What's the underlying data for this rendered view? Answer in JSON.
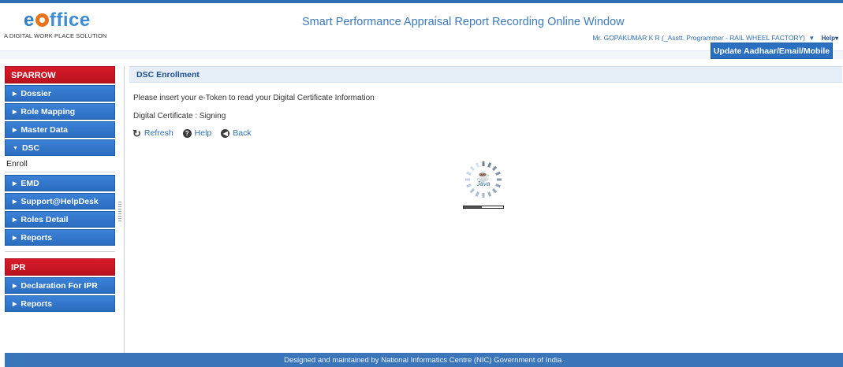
{
  "brand": {
    "logo_e": "e",
    "logo_rest": "ffice",
    "tagline": "A DIGITAL WORK PLACE SOLUTION"
  },
  "header": {
    "title": "Smart Performance Appraisal Report Recording Online Window",
    "user": "Mr. GOPAKUMAR K R",
    "role": "(_Asstt. Programmer - RAIL WHEEL FACTORY)",
    "help_label": "Help",
    "update_button": "Update Aadhaar/Email/Mobile"
  },
  "sidebar": {
    "sparrow": {
      "title": "SPARROW",
      "items": [
        {
          "label": "Dossier",
          "expanded": false
        },
        {
          "label": "Role Mapping",
          "expanded": false
        },
        {
          "label": "Master Data",
          "expanded": false
        },
        {
          "label": "DSC",
          "expanded": true
        },
        {
          "label": "EMD",
          "expanded": false
        },
        {
          "label": "Support@HelpDesk",
          "expanded": false
        },
        {
          "label": "Roles Detail",
          "expanded": false
        },
        {
          "label": "Reports",
          "expanded": false
        }
      ],
      "dsc_sub": [
        "Enroll"
      ]
    },
    "ipr": {
      "title": "IPR",
      "items": [
        {
          "label": "Declaration For IPR",
          "expanded": false
        },
        {
          "label": "Reports",
          "expanded": false
        }
      ]
    }
  },
  "main": {
    "panel_title": "DSC Enrollment",
    "instruction": "Please insert your e-Token to read your Digital Certificate Information",
    "certificate_line": "Digital Certificate : Signing",
    "actions": [
      {
        "label": "Refresh",
        "icon": "refresh-icon"
      },
      {
        "label": "Help",
        "icon": "help-icon"
      },
      {
        "label": "Back",
        "icon": "back-icon"
      }
    ],
    "loader": {
      "logo_text": "Java",
      "progress": 0.45
    }
  },
  "footer": {
    "text": "Designed and maintained by National Informatics Centre (NIC) Government of India."
  },
  "colors": {
    "accent_blue": "#2a6cc0",
    "section_red": "#c4141f",
    "panel_head": "#e6eef7",
    "footer_blue": "#3a76b9"
  }
}
